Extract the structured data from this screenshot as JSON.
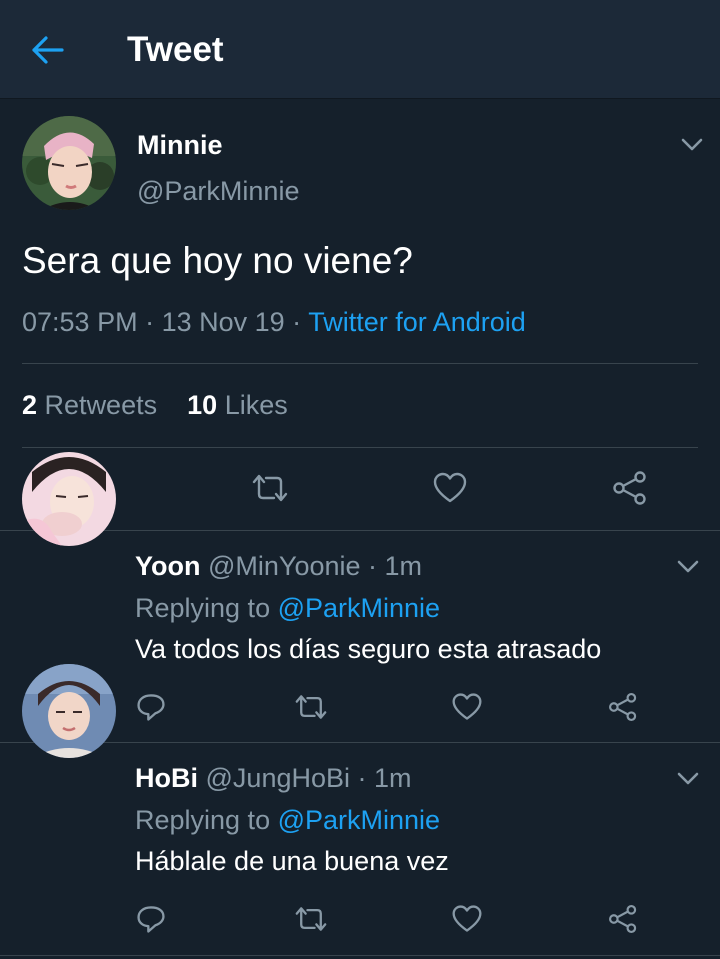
{
  "header": {
    "title": "Tweet",
    "back_icon": "arrow-left-icon"
  },
  "colors": {
    "background": "#15202b",
    "header": "#1c2938",
    "accent": "#1da1f2",
    "muted": "#8899a6"
  },
  "main_tweet": {
    "name": "Minnie",
    "handle": "@ParkMinnie",
    "text": "Sera que hoy no viene?",
    "time": "07:53 PM",
    "sep1": " · ",
    "date": "13 Nov 19",
    "sep2": " · ",
    "source": "Twitter for Android",
    "retweets_count": "2",
    "retweets_label": "Retweets",
    "likes_count": "10",
    "likes_label": "Likes"
  },
  "replies": [
    {
      "name": "Yoon",
      "handle": "@MinYoonie",
      "time": "· 1m",
      "replying_label": "Replying to",
      "replying_to": "@ParkMinnie",
      "text": "Va todos los días seguro esta atrasado"
    },
    {
      "name": "HoBi",
      "handle": "@JungHoBi",
      "time": "· 1m",
      "replying_label": "Replying to",
      "replying_to": "@ParkMinnie",
      "text": "Háblale de una buena vez"
    }
  ],
  "icons": [
    "reply-icon",
    "retweet-icon",
    "like-icon",
    "share-icon",
    "chevron-down-icon"
  ]
}
